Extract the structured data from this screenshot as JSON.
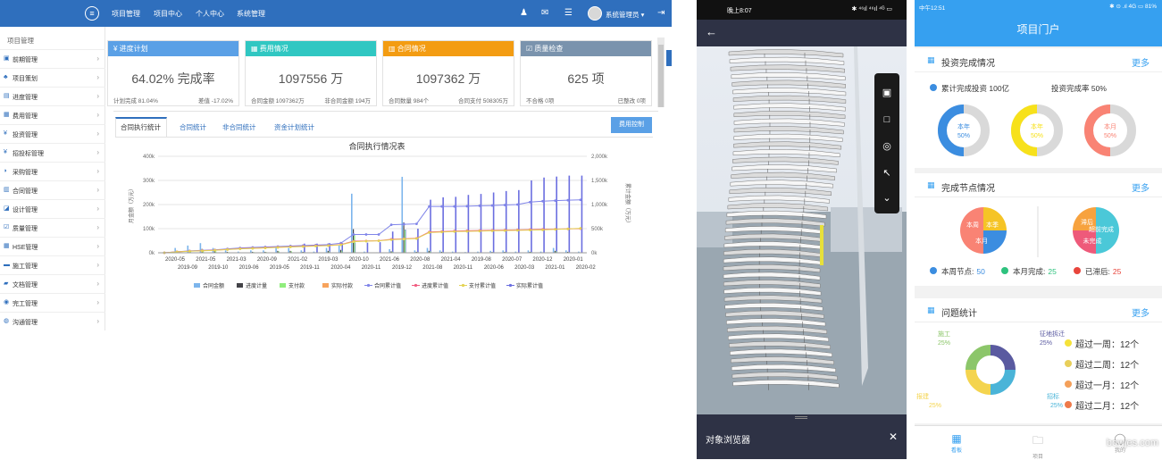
{
  "desktop": {
    "nav": [
      "项目管理",
      "项目中心",
      "个人中心",
      "系统管理"
    ],
    "user": "系统管理员",
    "sidebar_title": "项目管理",
    "sidebar": [
      {
        "label": "前期管理",
        "icon": "doc-icon"
      },
      {
        "label": "项目策划",
        "icon": "sitemap-icon"
      },
      {
        "label": "进度管理",
        "icon": "calendar-icon"
      },
      {
        "label": "费用管理",
        "icon": "money-icon"
      },
      {
        "label": "投资管理",
        "icon": "yen-icon"
      },
      {
        "label": "招投标管理",
        "icon": "yen-icon"
      },
      {
        "label": "采购管理",
        "icon": "purchase-icon"
      },
      {
        "label": "合同管理",
        "icon": "contract-icon"
      },
      {
        "label": "设计管理",
        "icon": "design-icon"
      },
      {
        "label": "质量管理",
        "icon": "check-icon"
      },
      {
        "label": "HSE管理",
        "icon": "grid-icon"
      },
      {
        "label": "施工管理",
        "icon": "truck-icon"
      },
      {
        "label": "文档管理",
        "icon": "folder-icon"
      },
      {
        "label": "完工管理",
        "icon": "flag-icon"
      },
      {
        "label": "沟通管理",
        "icon": "chat-icon"
      }
    ],
    "kpis": [
      {
        "title": "进度计划",
        "value": "64.02% 完成率",
        "left": "计划完成 81.04%",
        "right": "差值 -17.02%",
        "color": "#5aa0e6",
        "icon": "yen-icon"
      },
      {
        "title": "费用情况",
        "value": "1097556 万",
        "left": "合同金额 1097362万",
        "right": "非合同金额 194万",
        "color": "#30c7c2",
        "icon": "money-icon"
      },
      {
        "title": "合同情况",
        "value": "1097362 万",
        "left": "合同数量 984个",
        "right": "合同支付 508305万",
        "color": "#f39c12",
        "icon": "contract-icon"
      },
      {
        "title": "质量检查",
        "value": "625 项",
        "left": "不合格 0项",
        "right": "已整改 0项",
        "color": "#7a93ad",
        "icon": "check-icon"
      }
    ],
    "tabs": [
      "合同执行统计",
      "合同统计",
      "非合同统计",
      "资金计划统计"
    ],
    "cost_button": "费用控制"
  },
  "chart_data": {
    "type": "bar",
    "title": "合同执行情况表",
    "ylabel_left": "月金额（万元）",
    "ylabel_right": "累计金额（万元）",
    "y_ticks_left": [
      "0k",
      "100k",
      "200k",
      "300k",
      "400k"
    ],
    "y_ticks_right": [
      "0k",
      "500k",
      "1,000k",
      "1,500k",
      "2,000k"
    ],
    "ylim_left": [
      0,
      400000
    ],
    "ylim_right": [
      0,
      2000000
    ],
    "x_labels_top": [
      "2020-05",
      "2021-05",
      "2021-03",
      "2020-09",
      "2021-02",
      "2019-03",
      "2020-10",
      "2021-06",
      "2020-08",
      "2021-04",
      "2019-08",
      "2020-07",
      "2020-12",
      "2020-01"
    ],
    "x_labels_bottom": [
      "2019-09",
      "2019-10",
      "2019-06",
      "2019-05",
      "2019-11",
      "2020-04",
      "2020-11",
      "2019-12",
      "2021-08",
      "2020-11",
      "2020-06",
      "2020-03",
      "2021-01",
      "2020-02"
    ],
    "legend": [
      "合同金额",
      "进度计量",
      "支付款",
      "实际付款",
      "合同累计值",
      "进度累计值",
      "支付累计值",
      "实际累计值"
    ],
    "series_colors": [
      "#7cb5ec",
      "#434348",
      "#90ed7d",
      "#f7a35c",
      "#8085e9",
      "#f15c80",
      "#e4d354",
      "#6b6ee0"
    ],
    "contract_cumulative": [
      0,
      20000,
      40000,
      50000,
      60000,
      80000,
      100000,
      110000,
      120000,
      130000,
      140000,
      150000,
      160000,
      170000,
      200000,
      380000,
      380000,
      380000,
      580000,
      590000,
      600000,
      960000,
      960000,
      960000,
      965000,
      975000,
      980000,
      990000,
      1000000,
      1050000,
      1070000,
      1080000,
      1090000,
      1097000
    ],
    "progress_cumulative": [
      0,
      20000,
      35000,
      45000,
      55000,
      70000,
      85000,
      95000,
      105000,
      115000,
      125000,
      135000,
      145000,
      150000,
      170000,
      240000,
      245000,
      250000,
      280000,
      290000,
      300000,
      430000,
      440000,
      450000,
      455000,
      460000,
      465000,
      470000,
      475000,
      480000,
      485000,
      490000,
      495000,
      500000
    ],
    "payment_cumulative": [
      0,
      18000,
      32000,
      42000,
      52000,
      66000,
      80000,
      90000,
      100000,
      110000,
      120000,
      130000,
      140000,
      148000,
      165000,
      230000,
      240000,
      248000,
      270000,
      285000,
      295000,
      420000,
      430000,
      440000,
      445000,
      450000,
      455000,
      460000,
      465000,
      470000,
      475000,
      485000,
      495000,
      508000
    ],
    "actual_cumulative_bars": [
      0,
      0,
      0,
      0,
      0,
      0,
      0,
      0,
      0,
      0,
      0,
      190000,
      190000,
      200000,
      200000,
      210000,
      210000,
      220000,
      440000,
      480000,
      500000,
      1100000,
      1150000,
      1160000,
      1200000,
      1220000,
      1250000,
      1280000,
      1300000,
      1500000,
      1560000,
      1580000,
      1600000,
      1600000
    ],
    "monthly_contract": [
      0,
      20000,
      30000,
      40000,
      20000,
      10000,
      5000,
      10000,
      10000,
      20000,
      20000,
      10000,
      5000,
      20000,
      30000,
      245000,
      5000,
      2000,
      15000,
      315000,
      10000,
      20000,
      10000,
      5000,
      3000,
      5000,
      8000,
      10000,
      5000,
      10000,
      5000,
      20000,
      10000,
      5000
    ]
  },
  "bim": {
    "status_time": "晚上8:07",
    "status_icons": "✱ ⁴⁶ıl ⁴⁶ıl ⁴ᴳ ▭",
    "browser_label": "对象浏览器",
    "tools": [
      "cube-icon",
      "cube-outline-icon",
      "target-icon",
      "cursor-eye-icon",
      "collapse-icon"
    ]
  },
  "portal": {
    "status_time": "中午12:51",
    "status_icons": "✱ ⊙ .ıl 4G ▭ 81%",
    "header": "项目门户",
    "invest": {
      "title": "投资完成情况",
      "more": "更多",
      "total": "累计完成投资 100亿",
      "rate": "投资完成率 50%",
      "donuts": [
        {
          "label": "本年",
          "value": "50%",
          "percent": 50,
          "color": "#3b8de0"
        },
        {
          "label": "本年",
          "value": "50%",
          "percent": 50,
          "color": "#f7e11b"
        },
        {
          "label": "本月",
          "value": "50%",
          "percent": 50,
          "color": "#f98374"
        }
      ]
    },
    "nodes": {
      "title": "完成节点情况",
      "more": "更多",
      "pie1": [
        "本周",
        "本季",
        "本月"
      ],
      "pie2": [
        "滞后",
        "超前完成",
        "未完成"
      ],
      "stats": [
        {
          "label": "本周节点:",
          "value": "50",
          "color": "#3b8de0"
        },
        {
          "label": "本月完成:",
          "value": "25",
          "color": "#2ec27e"
        },
        {
          "label": "已滞后:",
          "value": "25",
          "color": "#e8453c"
        }
      ]
    },
    "issues": {
      "title": "问题统计",
      "more": "更多",
      "segments": [
        {
          "label": "征地拆迁",
          "value": "25%",
          "color": "#5a5aa0"
        },
        {
          "label": "招标",
          "value": "25%",
          "color": "#4ab4d8"
        },
        {
          "label": "报建",
          "value": "25%",
          "color": "#f4d44e"
        },
        {
          "label": "施工",
          "value": "25%",
          "color": "#8cc66a"
        }
      ],
      "list": [
        {
          "text": "超过一周：12个",
          "color": "#f5e23a"
        },
        {
          "text": "超过二周：12个",
          "color": "#e8cf5a"
        },
        {
          "text": "超过一月：12个",
          "color": "#f4a05a"
        },
        {
          "text": "超过二月：12个",
          "color": "#ee7a4a"
        }
      ]
    },
    "tabbar": [
      "看板",
      "项目",
      "我的"
    ],
    "watermark": "bowjes.com"
  }
}
